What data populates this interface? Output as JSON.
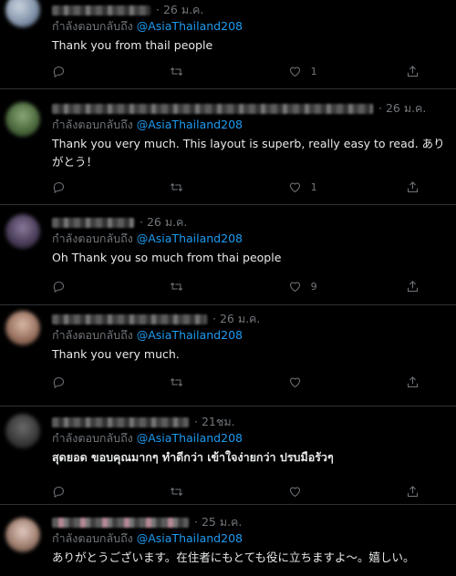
{
  "replying_prefix": "กำลังตอบกลับถึง",
  "replies": [
    {
      "time": "· 26 ม.ค.",
      "handle": "@AsiaThailand208",
      "text": "Thank you from thail people",
      "likes": "1"
    },
    {
      "time": "· 26 ม.ค.",
      "handle": "@AsiaThailand208",
      "text": "Thank you very much. This layout is superb, really easy to read. ありがとう！",
      "likes": "1"
    },
    {
      "time": "· 26 ม.ค.",
      "handle": "@AsiaThailand208",
      "text": "Oh Thank you so much from thai people",
      "likes": "9"
    },
    {
      "time": "· 26 ม.ค.",
      "handle": "@AsiaThailand208",
      "text": "Thank you very much.",
      "likes": ""
    },
    {
      "time": "· 21ชม.",
      "handle": "@AsiaThailand208",
      "text": "สุดยอด ขอบคุณมากๆ ทำดีกว่า เข้าใจง่ายกว่า ปรบมือรัวๆ",
      "likes": ""
    },
    {
      "time": "· 25 ม.ค.",
      "handle": "@AsiaThailand208",
      "text": "ありがとうございます。在住者にもとても役に立ちますよ〜。嬉しい。",
      "likes": ""
    }
  ]
}
